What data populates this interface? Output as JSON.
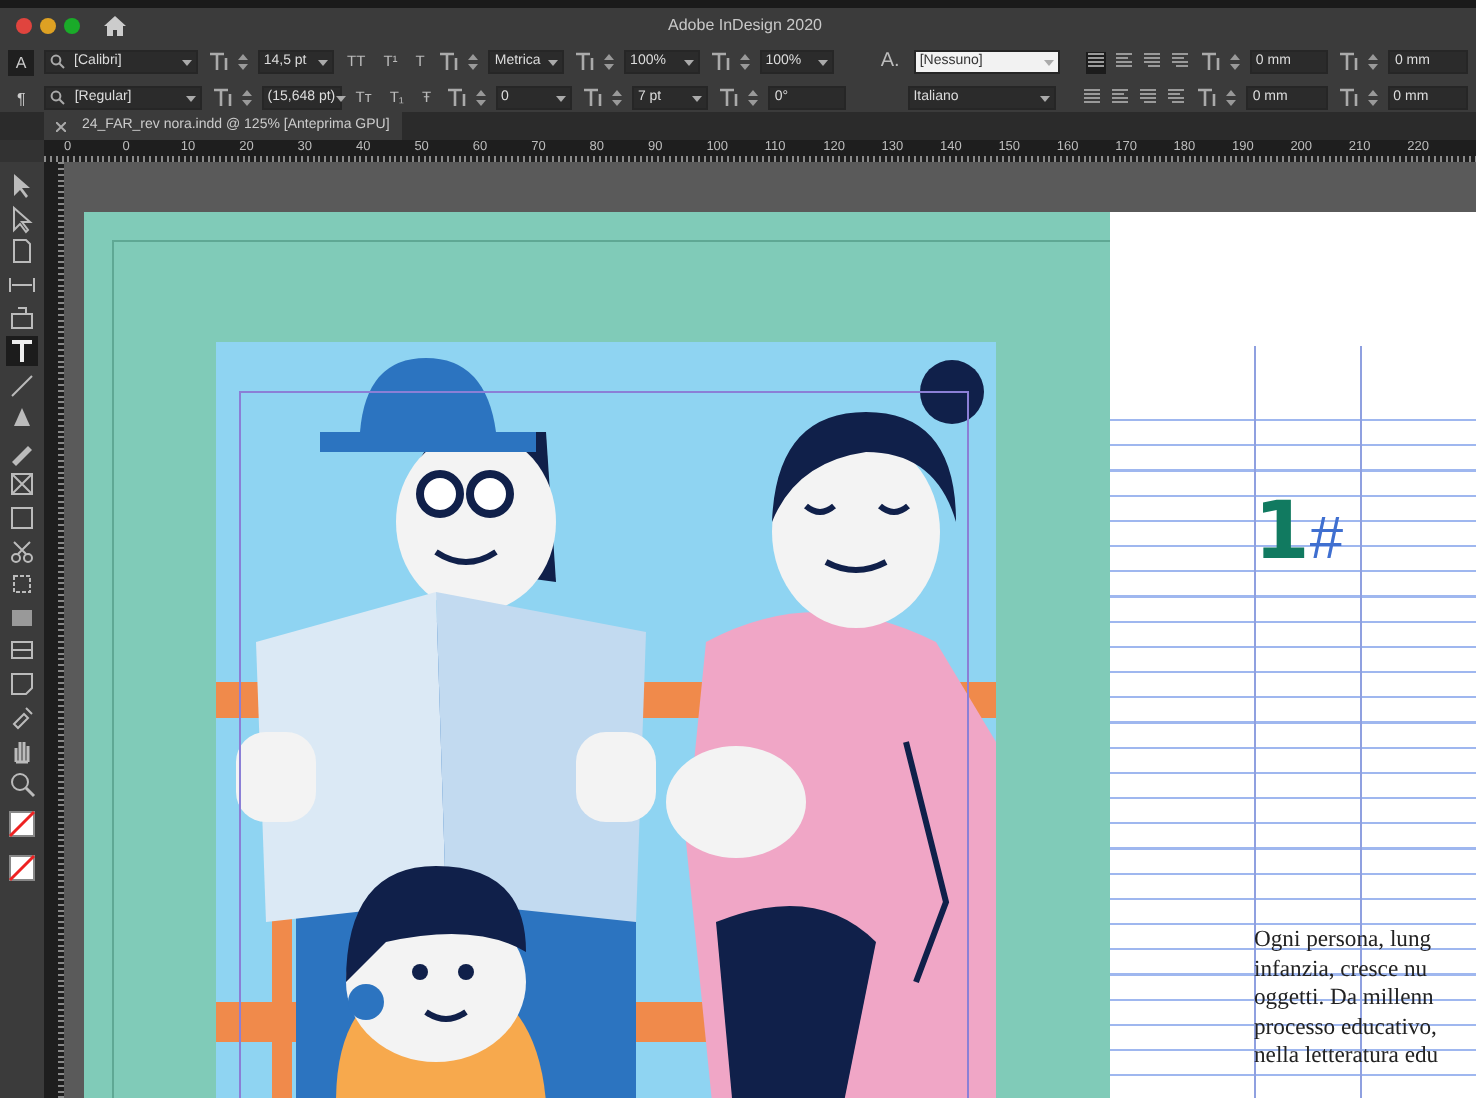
{
  "window": {
    "title": "Adobe InDesign 2020"
  },
  "control_panel": {
    "row_1": [
      {
        "kind": "mode",
        "text": "A",
        "selected": true
      },
      {
        "kind": "font-field",
        "value": "[Calibri]"
      },
      {
        "kind": "num-field",
        "value": "14,5 pt"
      },
      {
        "kind": "glyphs",
        "glyphs": [
          "TT",
          "T¹",
          "T"
        ]
      },
      {
        "kind": "num-field",
        "value": "Metrica"
      },
      {
        "kind": "num-field",
        "value": "100%"
      },
      {
        "kind": "num-field",
        "value": "100%"
      },
      {
        "kind": "label",
        "text": "A."
      },
      {
        "kind": "style-field",
        "value": "[Nessuno]"
      },
      {
        "kind": "align",
        "buttons": [
          {
            "selected": true
          },
          {
            "selected": false
          },
          {
            "selected": false
          },
          {
            "selected": false
          }
        ]
      },
      {
        "kind": "mm-field",
        "value": "0 mm"
      },
      {
        "kind": "mm-field",
        "value": "0 mm"
      }
    ],
    "row_2": [
      {
        "kind": "mode",
        "text": "¶",
        "selected": false
      },
      {
        "kind": "font-field",
        "value": "[Regular]"
      },
      {
        "kind": "num-field",
        "value": "(15,648 pt)"
      },
      {
        "kind": "glyphs",
        "glyphs": [
          "Tт",
          "T₁",
          "Ŧ"
        ]
      },
      {
        "kind": "num-field",
        "value": "0"
      },
      {
        "kind": "num-field",
        "value": "7 pt"
      },
      {
        "kind": "plain-field",
        "value": "0°"
      },
      {
        "kind": "spacer"
      },
      {
        "kind": "lang-field",
        "value": "Italiano"
      },
      {
        "kind": "align",
        "buttons": [
          {
            "selected": false
          },
          {
            "selected": false
          },
          {
            "selected": false
          },
          {
            "selected": false
          }
        ]
      },
      {
        "kind": "mm-field",
        "value": "0 mm"
      },
      {
        "kind": "mm-field",
        "value": "0 mm"
      }
    ]
  },
  "document_tab": {
    "label": "24_FAR_rev nora.indd @ 125% [Anteprima GPU]",
    "selected": true
  },
  "ruler": {
    "labels": [
      "0",
      "0",
      "10",
      "20",
      "30",
      "40",
      "50",
      "60",
      "70",
      "80",
      "90",
      "100",
      "110",
      "120",
      "130",
      "140",
      "150",
      "160",
      "170",
      "180",
      "190",
      "200",
      "210",
      "220"
    ]
  },
  "tools": [
    {
      "selected": false
    },
    {
      "selected": false
    },
    {
      "selected": false
    },
    {
      "selected": false
    },
    {
      "selected": false
    },
    {
      "selected": true
    },
    {
      "selected": false
    },
    {
      "selected": false
    },
    {
      "selected": false
    },
    {
      "selected": false
    },
    {
      "selected": false
    },
    {
      "selected": false
    },
    {
      "selected": false
    },
    {
      "selected": false
    },
    {
      "selected": false
    },
    {
      "selected": false
    },
    {
      "selected": false
    },
    {
      "selected": false
    },
    {
      "selected": false
    }
  ],
  "right_page": {
    "heading_number": "1",
    "heading_mark": "#",
    "body_lines": [
      "Ogni persona, lung",
      "infanzia, cresce nu",
      "oggetti. Da millenn",
      "processo educativo,",
      "nella letteratura edu"
    ]
  }
}
